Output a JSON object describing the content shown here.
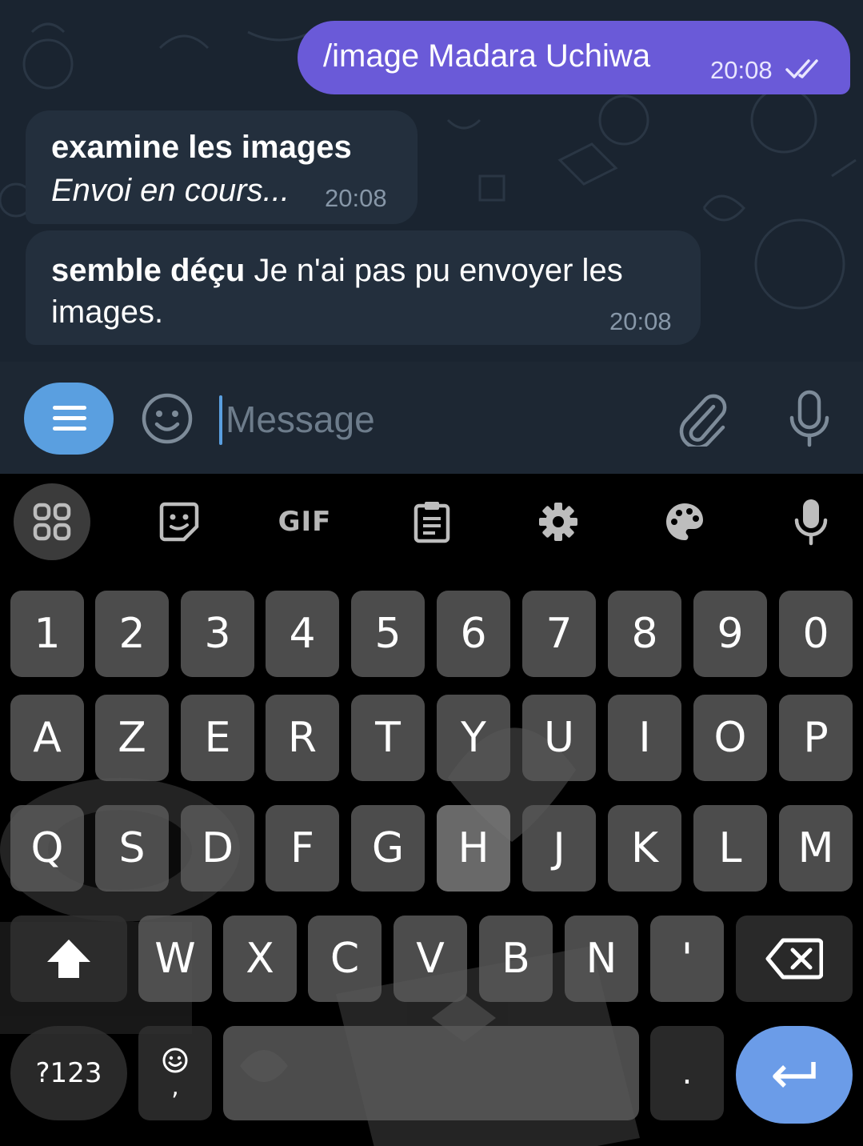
{
  "chat": {
    "outgoing": {
      "text": "/image Madara Uchiwa",
      "time": "20:08"
    },
    "incoming": [
      {
        "title": "examine les images",
        "subtitle": "Envoi en cours...",
        "time": "20:08"
      },
      {
        "bold": "semble déçu",
        "text_line1": " Je n'ai pas pu envoyer les",
        "text_line2": "images.",
        "time": "20:08"
      }
    ]
  },
  "input": {
    "placeholder": "Message"
  },
  "icons": {
    "menu": "menu-icon",
    "emoji": "emoji-icon",
    "attach": "paperclip-icon",
    "mic": "microphone-icon",
    "toolbar": [
      "apps-grid-icon",
      "sticker-icon",
      "gif-icon",
      "clipboard-icon",
      "gear-icon",
      "palette-icon",
      "microphone-icon"
    ]
  },
  "keyboard": {
    "toolbar_gif": "GIF",
    "row_numbers": [
      "1",
      "2",
      "3",
      "4",
      "5",
      "6",
      "7",
      "8",
      "9",
      "0"
    ],
    "row1": [
      "A",
      "Z",
      "E",
      "R",
      "T",
      "Y",
      "U",
      "I",
      "O",
      "P"
    ],
    "row2": [
      "Q",
      "S",
      "D",
      "F",
      "G",
      "H",
      "J",
      "K",
      "L",
      "M"
    ],
    "row3": [
      "W",
      "X",
      "C",
      "V",
      "B",
      "N",
      "'"
    ],
    "symbols_key": "?123",
    "comma_key": ",",
    "period_key": "."
  },
  "colors": {
    "outgoing_bubble": "#6a5ad8",
    "incoming_bubble": "#232f3d",
    "accent": "#5a9fe0",
    "enter_key": "#6b9ce8"
  }
}
